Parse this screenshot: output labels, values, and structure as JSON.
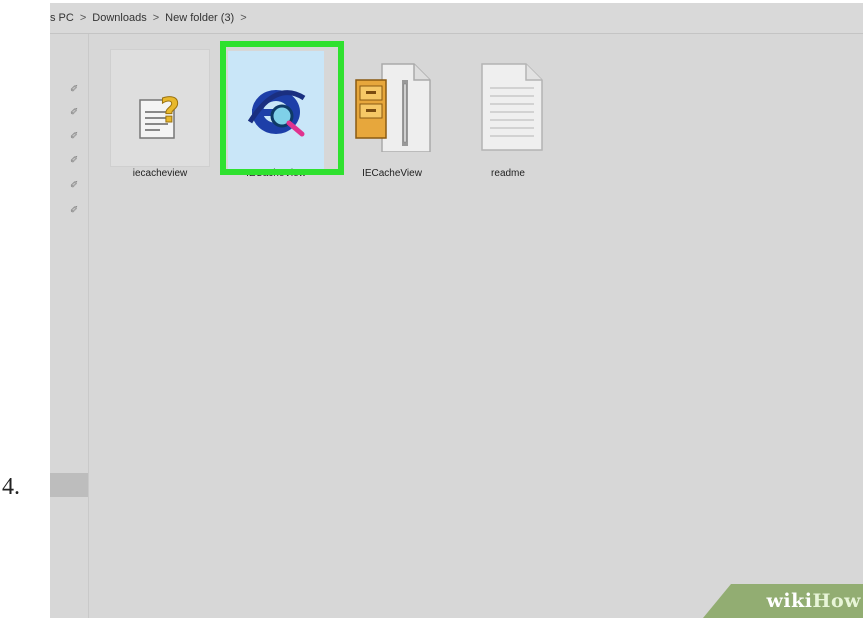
{
  "step": {
    "number": "4."
  },
  "breadcrumb": {
    "items": [
      "s PC",
      "Downloads",
      "New folder (3)"
    ],
    "separator": ">",
    "trailing_separator": ">"
  },
  "navpane": {
    "pin_icon": "pin-icon",
    "pin_count": 6
  },
  "files": [
    {
      "label": "iecacheview",
      "icon": "help-document-icon"
    },
    {
      "label": "IECacheView",
      "icon": "ie-application-icon",
      "selected": true
    },
    {
      "label": "IECacheView",
      "icon": "zip-archive-icon"
    },
    {
      "label": "readme",
      "icon": "text-document-icon"
    }
  ],
  "watermark": {
    "wiki": "wiki",
    "how": "How"
  },
  "colors": {
    "highlight": "#2fe12f",
    "selection": "#c9e6f8",
    "banner": "#92ad72"
  }
}
